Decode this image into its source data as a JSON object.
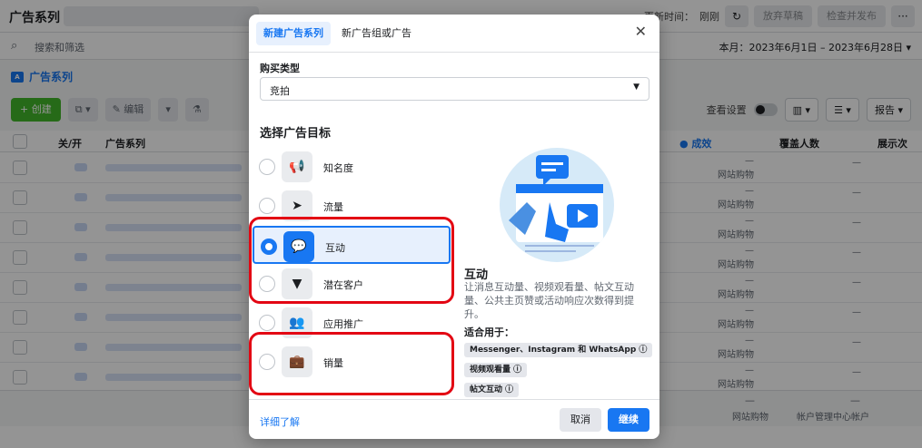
{
  "app": {
    "title": "广告系列",
    "update_label": "更新时间：",
    "update_value": "刚刚",
    "discard_label": "放弃草稿",
    "review_label": "检查并发布",
    "more_label": "···",
    "search_placeholder": "搜索和筛选",
    "date_range": "本月：2023年6月1日 – 2023年6月28日 ▾",
    "tab_label": "广告系列",
    "tab_badge": "A",
    "create_label": "+ 创建",
    "edit_label": "✎ 编辑",
    "view_settings": "查看设置",
    "report_label": "报告 ▾",
    "columns": {
      "onoff": "关/开",
      "campaign": "广告系列",
      "results": "● 成效",
      "reach": "覆盖人数",
      "impressions": "展示次"
    },
    "row_result": "网站购物",
    "dash": "—",
    "summary_result": "网站购物",
    "summary_account": "帐户管理中心帐户"
  },
  "dialog": {
    "tab_new_campaign": "新建广告系列",
    "tab_new_adset": "新广告组或广告",
    "close": "✕",
    "buy_type_label": "购买类型",
    "buy_type_value": "竞拍",
    "objective_title": "选择广告目标",
    "objectives": [
      {
        "label": "知名度",
        "icon": "megaphone-icon",
        "glyph": "📢"
      },
      {
        "label": "流量",
        "icon": "cursor-icon",
        "glyph": "➤"
      },
      {
        "label": "互动",
        "icon": "chat-bubbles-icon",
        "glyph": "💬"
      },
      {
        "label": "潜在客户",
        "icon": "funnel-icon",
        "glyph": "▼"
      },
      {
        "label": "应用推广",
        "icon": "people-icon",
        "glyph": "👥"
      },
      {
        "label": "销量",
        "icon": "briefcase-icon",
        "glyph": "💼"
      }
    ],
    "selected_index": 2,
    "description_title": "互动",
    "description_body": "让消息互动量、视频观看量、帖文互动量、公共主页赞或活动响应次数得到提升。",
    "suits_label": "适合用于：",
    "chips": [
      "Messenger、Instagram 和 WhatsApp ⓘ",
      "视频观看量 ⓘ",
      "帖文互动 ⓘ"
    ],
    "learn_more": "详细了解",
    "cancel": "取消",
    "continue": "继续"
  },
  "colors": {
    "accent": "#1877f2",
    "highlight_box": "#e30613",
    "create_green": "#42b72a"
  }
}
